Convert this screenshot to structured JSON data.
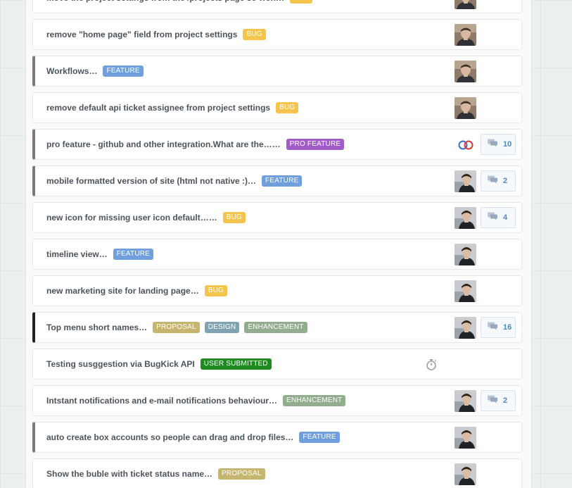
{
  "colors": {
    "bug": "#f4c44c",
    "feature": "#6f9fdd",
    "pro_feature": "#a25cc8",
    "proposal": "#c6b56f",
    "design": "#7fa3b0",
    "enhancement": "#92ad8d",
    "user_submitted": "#1c8a1e",
    "comment_count": "#4a8ac7",
    "title_text": "#4b545c"
  },
  "tickets": [
    {
      "title": "move the project settings from the /projects page so won…",
      "tags": [
        {
          "label": "BUG",
          "color": "#f4c44c"
        }
      ],
      "marked": false,
      "avatar": "user-avatar",
      "comments": null
    },
    {
      "title": "remove \"home page\" field from project settings",
      "tags": [
        {
          "label": "BUG",
          "color": "#f4c44c"
        }
      ],
      "marked": false,
      "avatar": "user-avatar",
      "comments": null
    },
    {
      "title": "Workflows…",
      "tags": [
        {
          "label": "FEATURE",
          "color": "#6f9fdd"
        }
      ],
      "marked": true,
      "avatar": "user-avatar",
      "comments": null
    },
    {
      "title": "remove default api ticket assignee from project settings",
      "tags": [
        {
          "label": "BUG",
          "color": "#f4c44c"
        }
      ],
      "marked": false,
      "avatar": "user-avatar",
      "comments": null
    },
    {
      "title": "pro feature - github and other integration.What are the……",
      "tags": [
        {
          "label": "PRO FEATURE",
          "color": "#a25cc8"
        }
      ],
      "marked": true,
      "avatar": "bot-avatar",
      "comments": "10"
    },
    {
      "title": "mobile formatted version of site (html not native :)…",
      "tags": [
        {
          "label": "FEATURE",
          "color": "#6f9fdd"
        }
      ],
      "marked": true,
      "avatar": "user-avatar",
      "comments": "2"
    },
    {
      "title": "new icon for missing user icon default……",
      "tags": [
        {
          "label": "BUG",
          "color": "#f4c44c"
        }
      ],
      "marked": false,
      "avatar": "user-avatar",
      "comments": "4"
    },
    {
      "title": "timeline view…",
      "tags": [
        {
          "label": "FEATURE",
          "color": "#6f9fdd"
        }
      ],
      "marked": false,
      "avatar": "user-avatar",
      "comments": null
    },
    {
      "title": "new marketing site for landing page…",
      "tags": [
        {
          "label": "BUG",
          "color": "#f4c44c"
        }
      ],
      "marked": false,
      "avatar": "user-avatar",
      "comments": null
    },
    {
      "title": "Top menu short names…",
      "tags": [
        {
          "label": "PROPOSAL",
          "color": "#c6b56f"
        },
        {
          "label": "DESIGN",
          "color": "#7fa3b0"
        },
        {
          "label": "ENHANCEMENT",
          "color": "#92ad8d"
        }
      ],
      "marked": "dark",
      "avatar": "user-avatar",
      "comments": "16"
    },
    {
      "title": "Testing susggestion via BugKick API",
      "tags": [
        {
          "label": "USER SUBMITTED",
          "color": "#1c8a1e"
        }
      ],
      "marked": false,
      "avatar": "timer-icon",
      "comments": null
    },
    {
      "title": "Intstant notifications and e-mail notifications behaviour…",
      "tags": [
        {
          "label": "ENHANCEMENT",
          "color": "#92ad8d"
        }
      ],
      "marked": false,
      "avatar": "user-avatar",
      "comments": "2"
    },
    {
      "title": "auto create box accounts so people can drag and drop files…",
      "tags": [
        {
          "label": "FEATURE",
          "color": "#6f9fdd"
        }
      ],
      "marked": true,
      "avatar": "user-avatar",
      "comments": null
    },
    {
      "title": "Show the buble with ticket status name…",
      "tags": [
        {
          "label": "PROPOSAL",
          "color": "#c6b56f"
        }
      ],
      "marked": false,
      "avatar": "user-avatar",
      "comments": null
    }
  ]
}
